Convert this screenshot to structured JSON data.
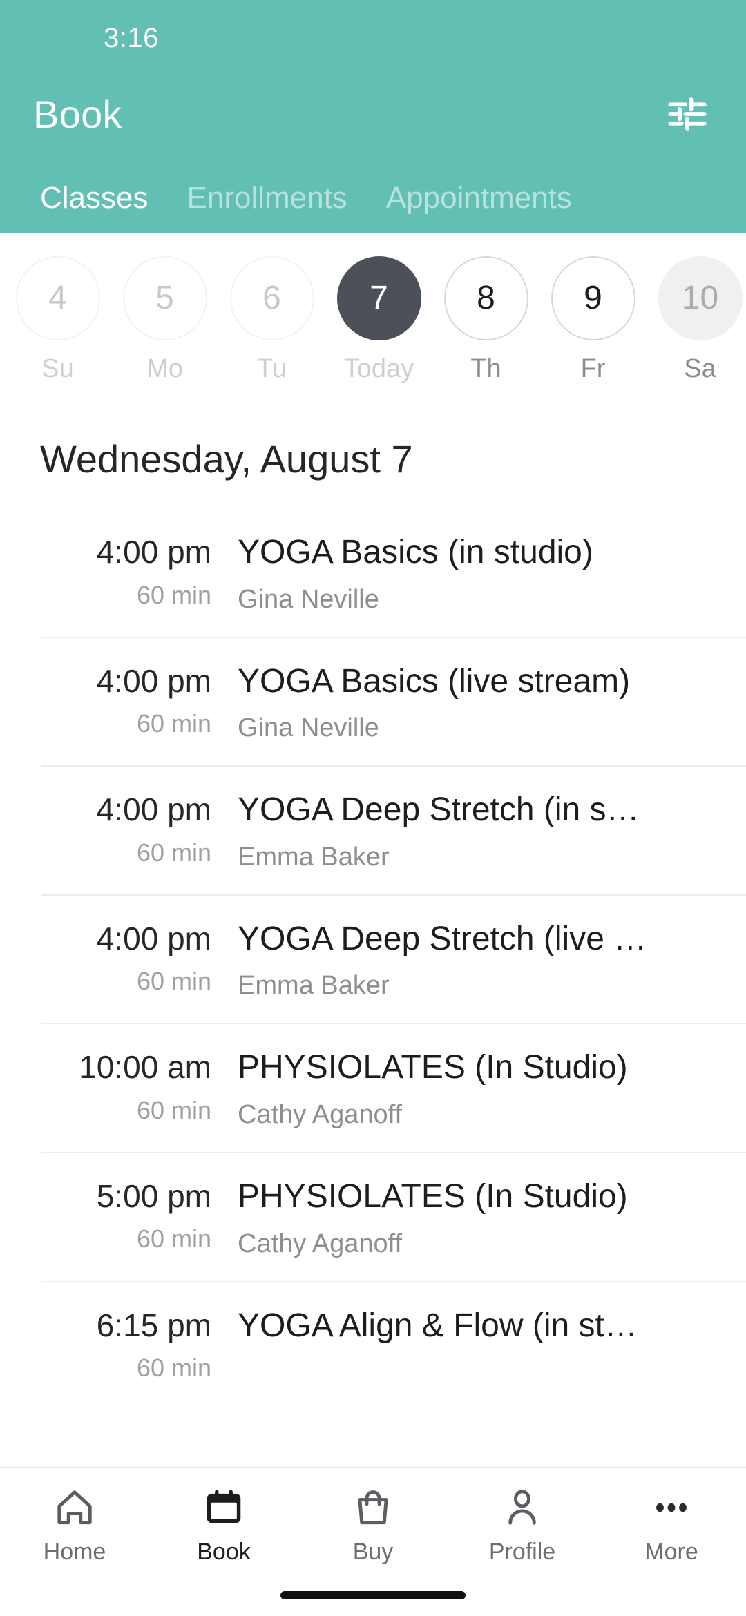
{
  "theme": {
    "header_teal": "#62BFB4",
    "selected_day": "#4C5058",
    "text_primary": "#1D1D1D",
    "text_muted": "#8E8E8E"
  },
  "status": {
    "time": "3:16"
  },
  "appbar": {
    "title": "Book",
    "filter_icon": "tune-filter-icon"
  },
  "tabs": [
    {
      "label": "Classes",
      "active": true
    },
    {
      "label": "Enrollments",
      "active": false
    },
    {
      "label": "Appointments",
      "active": false
    }
  ],
  "dates": [
    {
      "num": "4",
      "day": "Su",
      "state": "disabled"
    },
    {
      "num": "5",
      "day": "Mo",
      "state": "disabled"
    },
    {
      "num": "6",
      "day": "Tu",
      "state": "disabled"
    },
    {
      "num": "7",
      "day": "Today",
      "state": "selected"
    },
    {
      "num": "8",
      "day": "Th",
      "state": "normal"
    },
    {
      "num": "9",
      "day": "Fr",
      "state": "normal"
    },
    {
      "num": "10",
      "day": "Sa",
      "state": "soft"
    }
  ],
  "date_heading": "Wednesday, August 7",
  "classes": [
    {
      "time": "4:00 pm",
      "duration": "60 min",
      "title": "YOGA Basics (in studio)",
      "instructor": "Gina Neville"
    },
    {
      "time": "4:00 pm",
      "duration": "60 min",
      "title": "YOGA Basics (live stream)",
      "instructor": "Gina Neville"
    },
    {
      "time": "4:00 pm",
      "duration": "60 min",
      "title": "YOGA Deep Stretch (in s…",
      "instructor": "Emma Baker"
    },
    {
      "time": "4:00 pm",
      "duration": "60 min",
      "title": "YOGA Deep Stretch (live …",
      "instructor": "Emma Baker"
    },
    {
      "time": "10:00 am",
      "duration": "60 min",
      "title": "PHYSIOLATES (In Studio)",
      "instructor": "Cathy Aganoff"
    },
    {
      "time": "5:00 pm",
      "duration": "60 min",
      "title": "PHYSIOLATES (In Studio)",
      "instructor": "Cathy Aganoff"
    },
    {
      "time": "6:15 pm",
      "duration": "60 min",
      "title": "YOGA Align & Flow (in st…",
      "instructor": ""
    }
  ],
  "bottomnav": [
    {
      "label": "Home",
      "icon": "home-icon",
      "active": false
    },
    {
      "label": "Book",
      "icon": "calendar-icon",
      "active": true
    },
    {
      "label": "Buy",
      "icon": "bag-icon",
      "active": false
    },
    {
      "label": "Profile",
      "icon": "person-icon",
      "active": false
    },
    {
      "label": "More",
      "icon": "dots-icon",
      "active": false
    }
  ]
}
